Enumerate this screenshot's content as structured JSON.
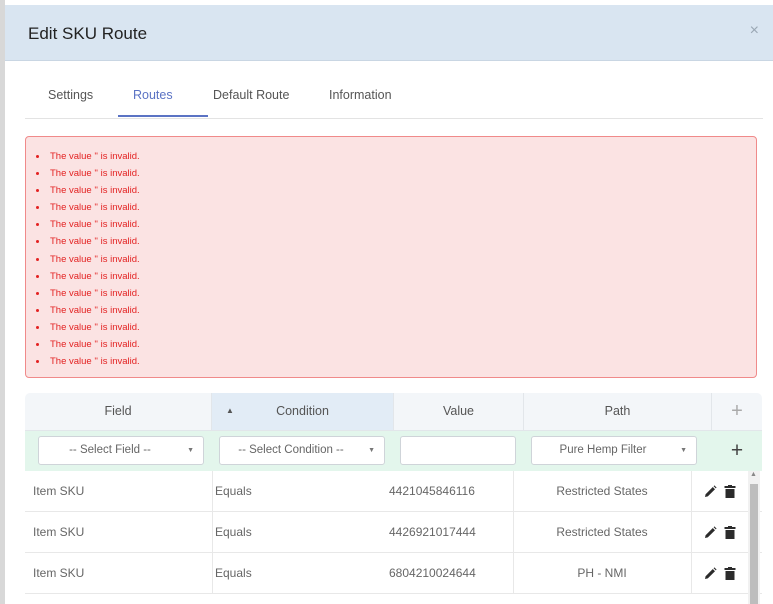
{
  "modal": {
    "title": "Edit SKU Route",
    "close_symbol": "×"
  },
  "tabs": [
    {
      "label": "Settings",
      "active": false
    },
    {
      "label": "Routes",
      "active": true
    },
    {
      "label": "Default Route",
      "active": false
    },
    {
      "label": "Information",
      "active": false
    }
  ],
  "errors": [
    "The value '' is invalid.",
    "The value '' is invalid.",
    "The value '' is invalid.",
    "The value '' is invalid.",
    "The value '' is invalid.",
    "The value '' is invalid.",
    "The value '' is invalid.",
    "The value '' is invalid.",
    "The value '' is invalid.",
    "The value '' is invalid.",
    "The value '' is invalid.",
    "The value '' is invalid.",
    "The value '' is invalid."
  ],
  "grid": {
    "columns": [
      "Field",
      "Condition",
      "Value",
      "Path"
    ],
    "sorted_column": "Condition",
    "sort_direction": "ascending",
    "add_symbol": "+",
    "filters": {
      "field": "-- Select Field --",
      "condition": "-- Select Condition --",
      "value": "",
      "path": "Pure Hemp Filter"
    },
    "rows": [
      {
        "field": "Item SKU",
        "condition": "Equals",
        "value": "4421045846116",
        "path": "Restricted States"
      },
      {
        "field": "Item SKU",
        "condition": "Equals",
        "value": "4426921017444",
        "path": "Restricted States"
      },
      {
        "field": "Item SKU",
        "condition": "Equals",
        "value": "6804210024644",
        "path": "PH - NMI"
      }
    ]
  },
  "icons": {
    "edit": "pencil-icon",
    "delete": "trash-icon",
    "sort": "sort-ascending-icon",
    "caret": "chevron-down-icon"
  },
  "colors": {
    "header_bg": "#d9e5f1",
    "accent": "#5b73c4",
    "error_text": "#e32222",
    "error_bg": "#fbe3e3",
    "filter_row_bg": "#e3f6ec"
  }
}
